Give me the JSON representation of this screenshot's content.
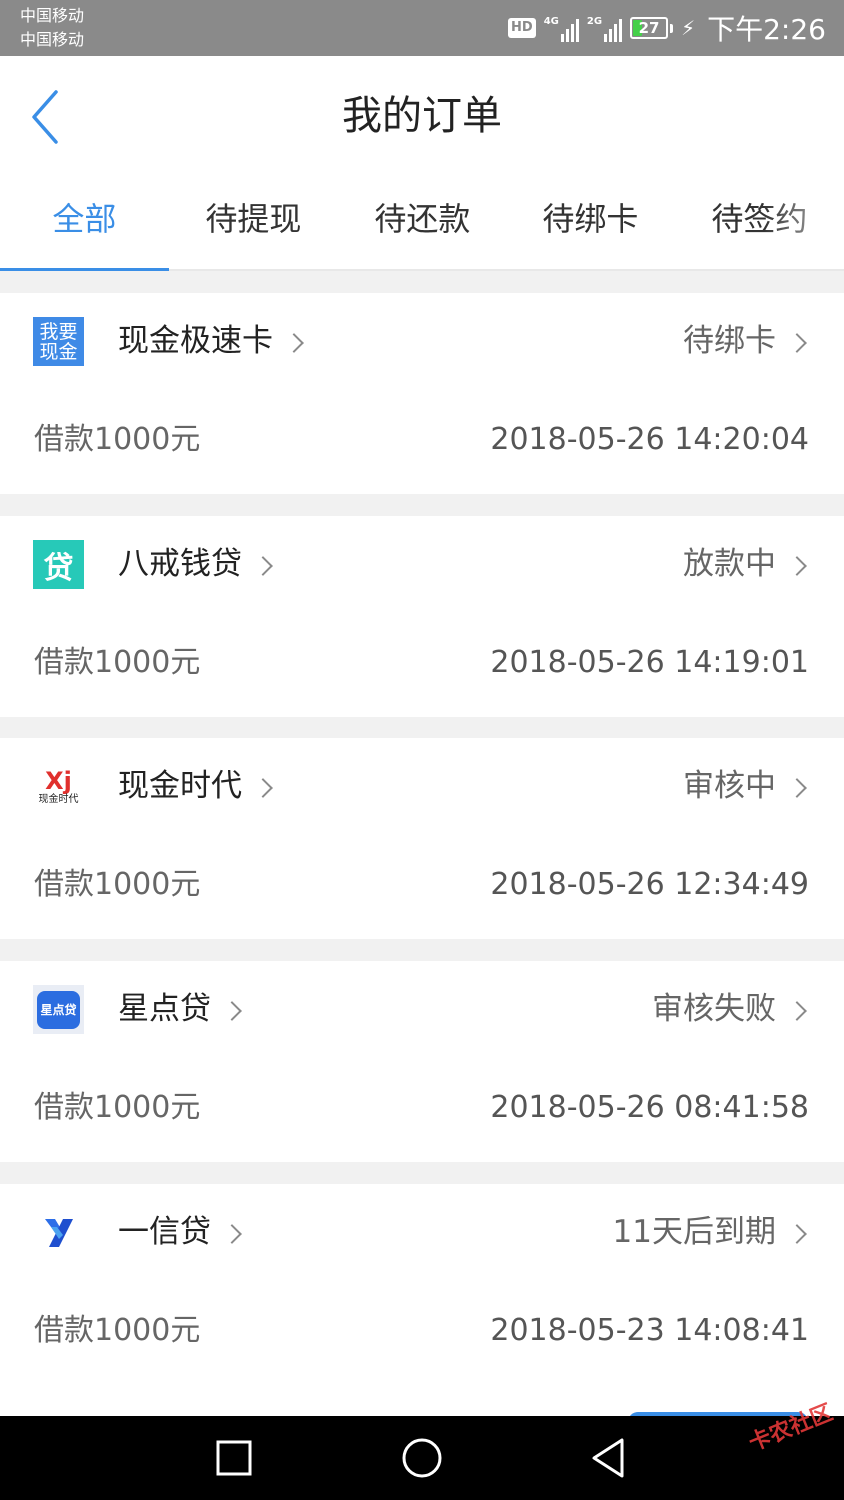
{
  "status_bar": {
    "carrier1": "中国移动",
    "carrier2": "中国移动",
    "hd": "HD",
    "net1": "4G",
    "net2": "2G",
    "battery": "27",
    "time": "下午2:26"
  },
  "header": {
    "title": "我的订单"
  },
  "tabs": [
    {
      "label": "全部"
    },
    {
      "label": "待提现"
    },
    {
      "label": "待还款"
    },
    {
      "label": "待绑卡"
    },
    {
      "label": "待签约"
    }
  ],
  "active_tab_index": 0,
  "colors": {
    "accent": "#3a8ee6",
    "background": "#f1f1f1"
  },
  "orders": [
    {
      "name": "现金极速卡",
      "status": "待绑卡",
      "amount": "借款1000元",
      "time": "2018-05-26 14:20:04",
      "logo_icon": "woyao-xianjin-logo-icon"
    },
    {
      "name": "八戒钱贷",
      "status": "放款中",
      "amount": "借款1000元",
      "time": "2018-05-26 14:19:01",
      "logo_icon": "dai-logo-icon"
    },
    {
      "name": "现金时代",
      "status": "审核中",
      "amount": "借款1000元",
      "time": "2018-05-26 12:34:49",
      "logo_icon": "xj-logo-icon"
    },
    {
      "name": "星点贷",
      "status": "审核失败",
      "amount": "借款1000元",
      "time": "2018-05-26 08:41:58",
      "logo_icon": "xingdiandai-logo-icon"
    },
    {
      "name": "一信贷",
      "status": "11天后到期",
      "amount": "借款1000元",
      "time": "2018-05-23 14:08:41",
      "logo_icon": "yixindai-logo-icon"
    }
  ],
  "logos": {
    "woyao_line1": "我要",
    "woyao_line2": "现金",
    "dai_char": "贷",
    "xj_text": "Xj",
    "xj_sub": "现金时代",
    "xingdian_text": "星点贷"
  },
  "watermark": "卡农社区"
}
